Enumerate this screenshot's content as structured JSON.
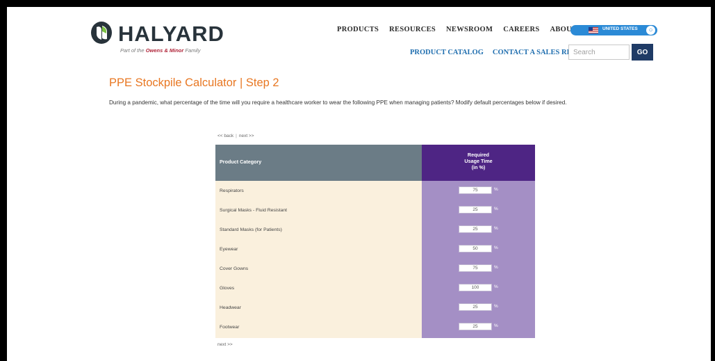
{
  "brand": {
    "name": "HALYARD",
    "tagline_prefix": "Part of the",
    "tagline_company": "Owens & Minor",
    "tagline_suffix": "Family",
    "primary_color": "#28333b",
    "accent_orange": "#e87722",
    "nav_blue": "#1f6eaf",
    "header_purple": "#4e2584",
    "header_gray": "#6b7c86"
  },
  "top_nav": [
    "PRODUCTS",
    "RESOURCES",
    "NEWSROOM",
    "CAREERS",
    "ABOUT US"
  ],
  "country_selector": {
    "label": "UNITED STATES",
    "icon": "globe-icon"
  },
  "sub_nav": [
    "PRODUCT CATALOG",
    "CONTACT A SALES REP"
  ],
  "search": {
    "placeholder": "Search",
    "button_label": "GO"
  },
  "page": {
    "title": "PPE Stockpile Calculator | Step 2",
    "intro": "During a pandemic, what percentage of the time will you require a healthcare worker to wear the following PPE when managing patients? Modify default percentages below if desired.",
    "back_link": "<< back",
    "separator": "|",
    "next_link": "next >>",
    "next_link_bottom": "next >>"
  },
  "calculator": {
    "header_category": "Product Category",
    "header_usage_line1": "Required",
    "header_usage_line2": "Usage Time",
    "header_usage_line3": "(in %)",
    "percent_symbol": "%",
    "rows": [
      {
        "label": "Respirators",
        "value": "75"
      },
      {
        "label": "Surgical Masks - Fluid Resistant",
        "value": "25"
      },
      {
        "label": "Standard Masks (for Patients)",
        "value": "25"
      },
      {
        "label": "Eyewear",
        "value": "50"
      },
      {
        "label": "Cover Gowns",
        "value": "75"
      },
      {
        "label": "Gloves",
        "value": "100"
      },
      {
        "label": "Headwear",
        "value": "25"
      },
      {
        "label": "Footwear",
        "value": "25"
      }
    ]
  }
}
